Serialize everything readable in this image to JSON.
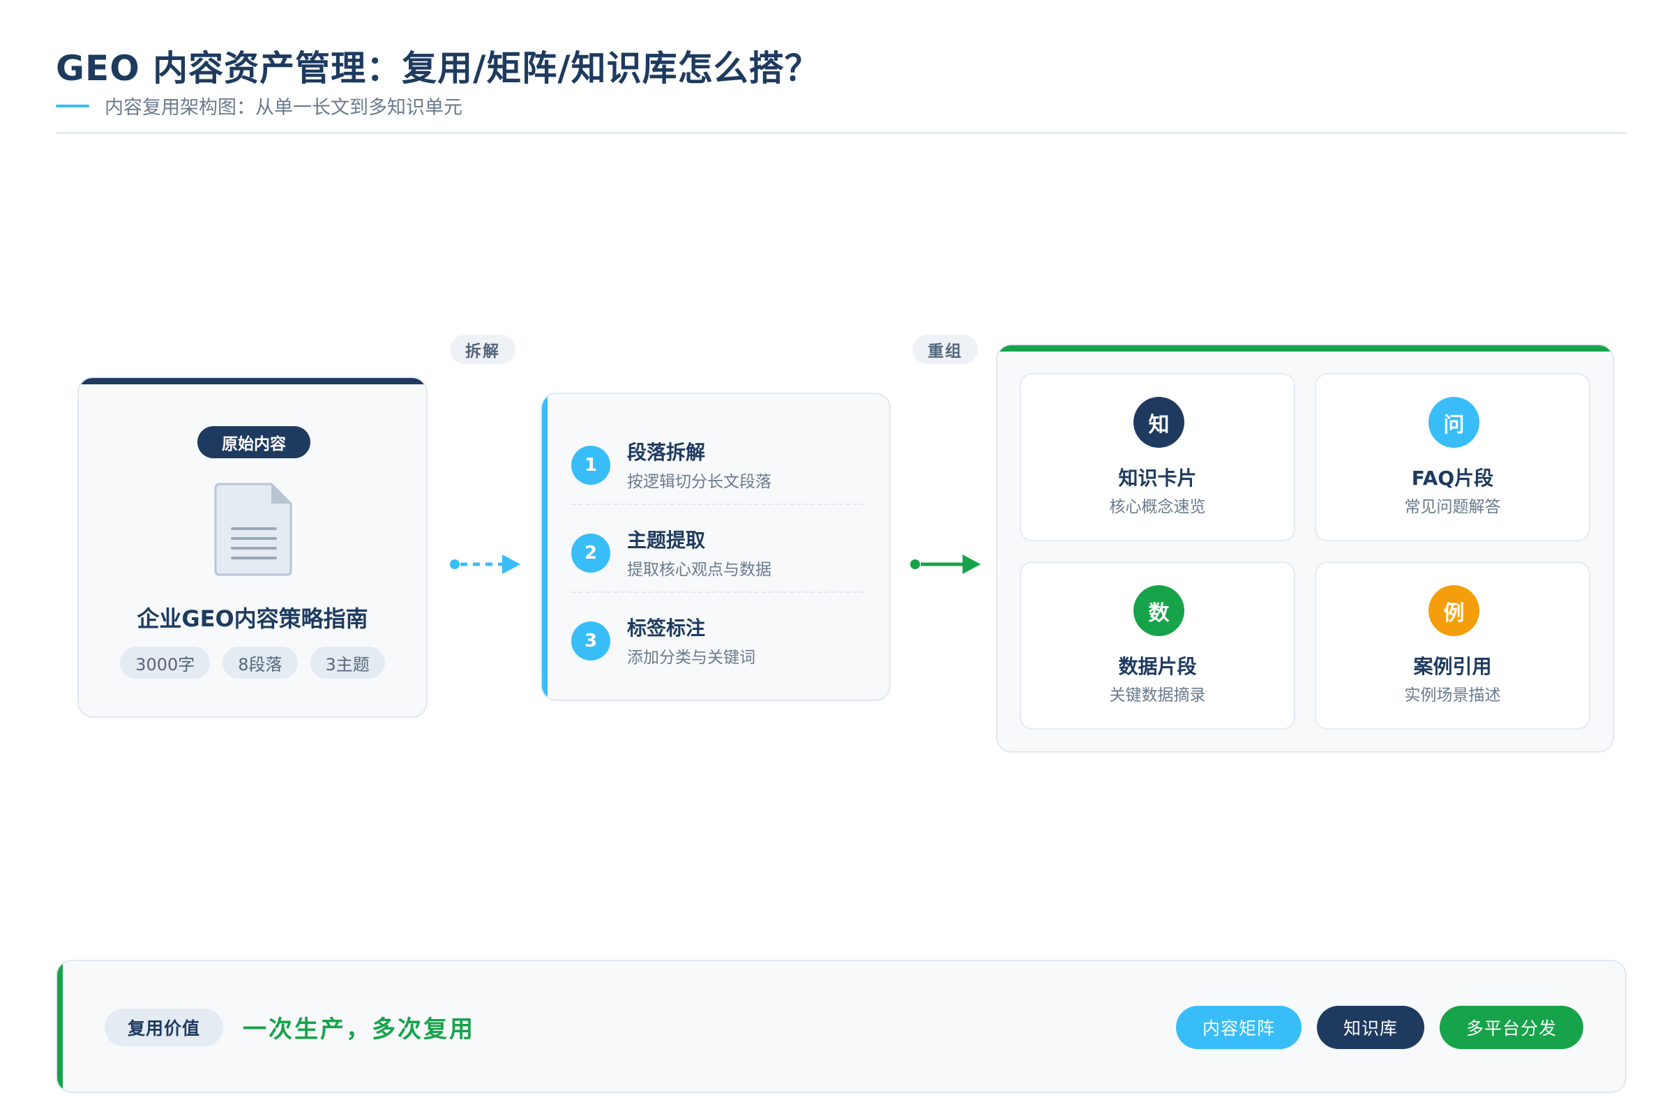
{
  "header": {
    "title": "GEO 内容资产管理：复用/矩阵/知识库怎么搭？",
    "subtitle": "内容复用架构图：从单一长文到多知识单元"
  },
  "source": {
    "badge": "原始内容",
    "doc_icon": "document-icon",
    "title": "企业GEO内容策略指南",
    "chips": [
      "3000字",
      "8段落",
      "3主题"
    ]
  },
  "flow": {
    "split_label": "拆解",
    "recombine_label": "重组"
  },
  "steps": [
    {
      "num": "1",
      "title": "段落拆解",
      "desc": "按逻辑切分长文段落"
    },
    {
      "num": "2",
      "title": "主题提取",
      "desc": "提取核心观点与数据"
    },
    {
      "num": "3",
      "title": "标签标注",
      "desc": "添加分类与关键词"
    }
  ],
  "units": [
    {
      "icon": "知",
      "title": "知识卡片",
      "desc": "核心概念速览",
      "color": "#1e3a5f"
    },
    {
      "icon": "问",
      "title": "FAQ片段",
      "desc": "常见问题解答",
      "color": "#38bdf8"
    },
    {
      "icon": "数",
      "title": "数据片段",
      "desc": "关键数据摘录",
      "color": "#16a34a"
    },
    {
      "icon": "例",
      "title": "案例引用",
      "desc": "实例场景描述",
      "color": "#f59e0b"
    }
  ],
  "value": {
    "tag": "复用价值",
    "text": "一次生产，多次复用",
    "buttons": [
      {
        "label": "内容矩阵",
        "color": "#38bdf8"
      },
      {
        "label": "知识库",
        "color": "#1e3a5f"
      },
      {
        "label": "多平台分发",
        "color": "#16a34a"
      }
    ]
  },
  "colors": {
    "navy": "#1e3a5f",
    "sky": "#38bdf8",
    "green": "#16a34a",
    "amber": "#f59e0b"
  }
}
